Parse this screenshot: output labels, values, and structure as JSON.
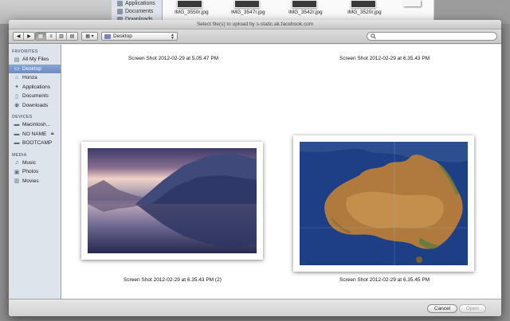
{
  "background_window": {
    "sidebar": [
      "Applications",
      "Documents",
      "Downloads"
    ],
    "files": [
      "IMG_3550r.jpg",
      "IMG_3547r.jpg",
      "IMG_3542r.jpg",
      "IMG_3520r.jpg"
    ]
  },
  "dialog": {
    "title": "Select file(s) to upload by s-static.ak.facebook.com",
    "toolbar": {
      "back_icon": "◀",
      "forward_icon": "▶",
      "view_icons": [
        "▦",
        "≡",
        "▥",
        "▤"
      ],
      "arrange_icon": "▦ ▾",
      "location": "Desktop",
      "search_placeholder": ""
    },
    "sidebar": {
      "favorites_heading": "FAVORITES",
      "favorites": [
        "All My Files",
        "Desktop",
        "Honza",
        "Applications",
        "Documents",
        "Downloads"
      ],
      "devices_heading": "DEVICES",
      "devices": [
        "Macintosh...",
        "NO NAME",
        "BOOTCAMP"
      ],
      "media_heading": "MEDIA",
      "media": [
        "Music",
        "Photos",
        "Movies"
      ],
      "selected": "Desktop"
    },
    "files": [
      {
        "label": "Screen Shot 2012-02-29 at 5.05.47 PM"
      },
      {
        "label": "Screen Shot 2012-02-29 at 6.35.43 PM"
      },
      {
        "label": "Screen Shot 2012-02-29 at 6.35.43 PM (2)"
      },
      {
        "label": "Screen Shot 2012-02-29 at 6.35.45 PM"
      }
    ],
    "footer": {
      "cancel": "Cancel",
      "open": "Open"
    }
  },
  "colors": {
    "sidebar_selection": "#7393c6",
    "sidebar_bg": "#dde4ec"
  }
}
